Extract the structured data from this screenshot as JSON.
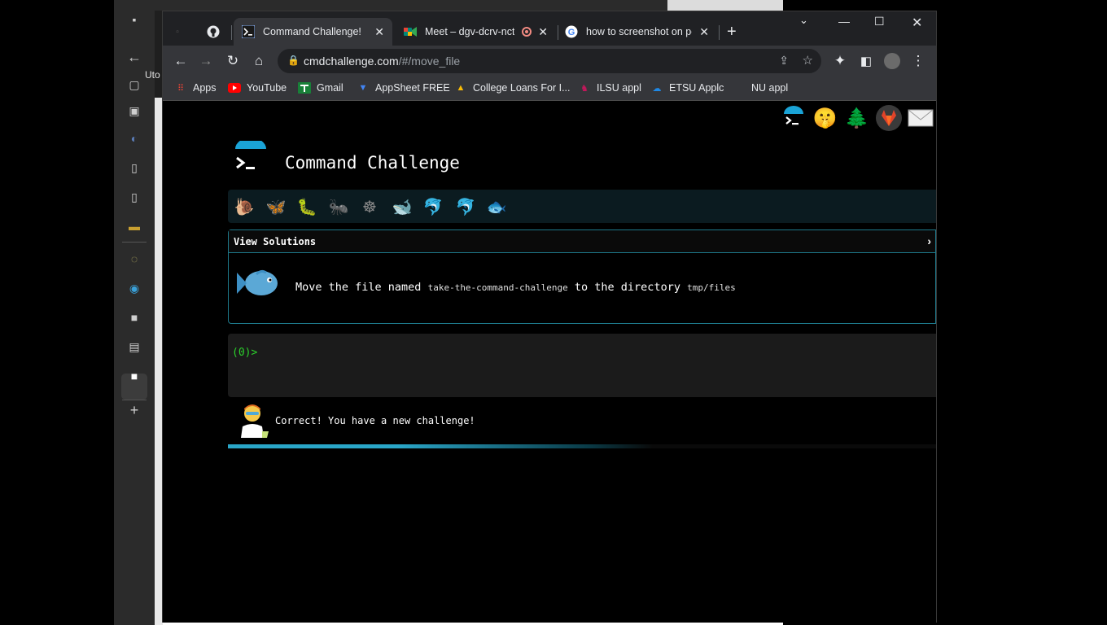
{
  "background_window": {
    "tab_label": "Uto"
  },
  "browser": {
    "tabs": [
      {
        "title": "",
        "icon": "blank-tab-icon"
      },
      {
        "title": "",
        "icon": "github-icon"
      },
      {
        "title": "Command Challenge!",
        "icon": "terminal-icon",
        "active": true
      },
      {
        "title": "Meet – dgv-dcrv-nct",
        "icon": "google-meet-icon",
        "recording": true
      },
      {
        "title": "how to screenshot on pc",
        "icon": "google-icon"
      }
    ],
    "url_host": "cmdchallenge.com",
    "url_path": "/#/move_file",
    "bookmarks": [
      {
        "label": "Apps",
        "icon": "apps-grid-icon"
      },
      {
        "label": "YouTube",
        "icon": "youtube-icon"
      },
      {
        "label": "Gmail",
        "icon": "gmail-icon"
      },
      {
        "label": "AppSheet FREE",
        "icon": "appsheet-icon"
      },
      {
        "label": "College Loans For I...",
        "icon": "loans-icon"
      },
      {
        "label": "ILSU appl",
        "icon": "ilsu-icon"
      },
      {
        "label": "ETSU Applc",
        "icon": "cloud-icon"
      },
      {
        "label": "NU appl",
        "icon": "blank-icon"
      }
    ]
  },
  "page": {
    "brand": "Command Challenge",
    "levels": [
      "snail",
      "butterfly",
      "caterpillar",
      "ant",
      "ship-wheel",
      "whale",
      "dolphin",
      "dolphin2",
      "fish"
    ],
    "view_solutions_label": "View Solutions",
    "task_prefix": "Move the file named",
    "task_file": "take-the-command-challenge",
    "task_middle": "to the directory",
    "task_dir": "tmp/files",
    "prompt": "(0)>",
    "feedback": "Correct! You have a new challenge!",
    "progress_fraction": 0.6
  },
  "colors": {
    "accent": "#2aa6c8",
    "prompt_green": "#2bd12b",
    "border_teal": "#1e7a8c"
  }
}
